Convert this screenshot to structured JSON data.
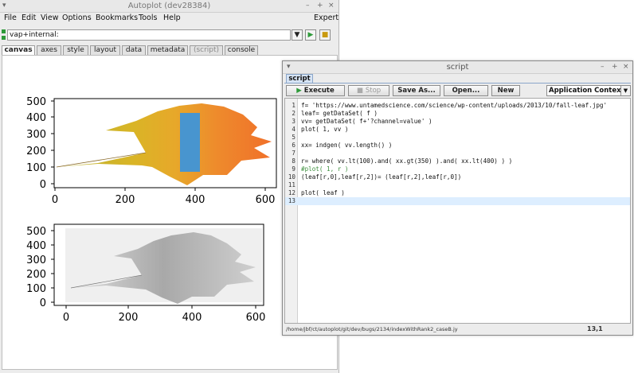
{
  "main_window": {
    "title": "Autoplot (dev28384)",
    "menu": [
      "File",
      "Edit",
      "View",
      "Options",
      "Bookmarks",
      "Tools",
      "Help"
    ],
    "expert_label": "Expert",
    "address_value": "vap+internal:",
    "tabs": [
      "canvas",
      "axes",
      "style",
      "layout",
      "data",
      "metadata",
      "(script)",
      "console"
    ],
    "active_tab": "canvas"
  },
  "plots": {
    "top": {
      "y_ticks": [
        "500",
        "400",
        "300",
        "200",
        "100",
        "0"
      ],
      "x_ticks": [
        "0",
        "200",
        "400",
        "600"
      ]
    },
    "bottom": {
      "y_ticks": [
        "500",
        "400",
        "300",
        "200",
        "100",
        "0"
      ],
      "x_ticks": [
        "0",
        "200",
        "400",
        "600"
      ]
    }
  },
  "script_window": {
    "title": "script",
    "tab_label": "script",
    "buttons": {
      "execute": "Execute",
      "stop": "Stop",
      "save_as": "Save As...",
      "open": "Open...",
      "new": "New"
    },
    "context_select": "Application Context",
    "code": [
      {
        "n": "1",
        "text": "f= 'https://www.untamedscience.com/science/wp-content/uploads/2013/10/fall-leaf.jpg'"
      },
      {
        "n": "2",
        "text": "leaf= getDataSet( f )"
      },
      {
        "n": "3",
        "text": "vv= getDataSet( f+'?channel=value' )"
      },
      {
        "n": "4",
        "text": "plot( 1, vv )"
      },
      {
        "n": "5",
        "text": ""
      },
      {
        "n": "6",
        "text": "xx= indgen( vv.length() )"
      },
      {
        "n": "7",
        "text": ""
      },
      {
        "n": "8",
        "text": "r= where( vv.lt(100).and( xx.gt(350) ).and( xx.lt(400) ) )"
      },
      {
        "n": "9",
        "text": "#plot( 1, r )"
      },
      {
        "n": "10",
        "text": "(leaf[r,0],leaf[r,2])= (leaf[r,2],leaf[r,0])"
      },
      {
        "n": "11",
        "text": ""
      },
      {
        "n": "12",
        "text": "plot( leaf )"
      },
      {
        "n": "13",
        "text": ""
      }
    ],
    "current_line": "13",
    "status_path": "/home/jbf/ct/autoplot/git/dev/bugs/2134/indexWithRank2_caseB.jy",
    "cursor_position": "13,1"
  }
}
